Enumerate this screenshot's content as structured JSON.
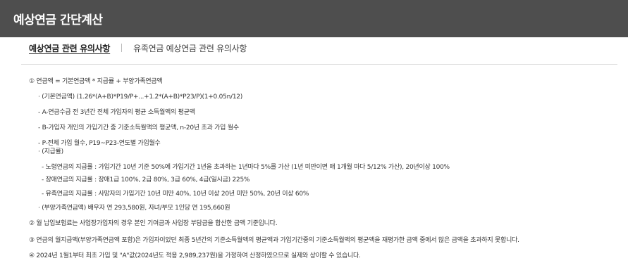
{
  "header": {
    "title": "예상연금 간단계산"
  },
  "tabs": [
    {
      "label": "예상연금 관련 유의사항",
      "active": true
    },
    {
      "label": "유족연금 예상연금 관련 유의사항",
      "active": false
    }
  ],
  "notes": {
    "n1": "① 연금액 = 기본연금액 * 지급률 + 부양가족연금액",
    "n1_a": "· (기본연금액) (1.26*(A+B)*P19/P+...+1.2*(A+B)*P23/P)(1+0.05n/12)",
    "n1_b": "- A-연금수급 전 3년간 전체 가입자의 평균 소득월액의 평균액",
    "n1_c": "- B-가입자 개인의 가입기간 중 기준소득월액의 평균액, n-20년 초과 가입 월수",
    "n1_d": "- P-전체 가입 월수, P19~P23-연도별 가입월수",
    "n1_e": "· (지급률)",
    "n1_e1": "- 노령연금의 지급률 : 가입기간 10년 기준 50%에 가입기간 1년을 초과하는 1년마다 5%를 가산 (1년 미만이면 매 1개월 마다 5/12% 가산), 20년이상 100%",
    "n1_e2": "- 장애연금의 지급률 : 장애1급 100%, 2급 80%, 3급 60%, 4급(일시금) 225%",
    "n1_e3": "- 유족연금의 지급률 : 사망자의 가입기간 10년 미만 40%, 10년 이상 20년 미만 50%, 20년 이상 60%",
    "n1_f": "· (부양가족연금액) 배우자 연 293,580원, 자녀/부모 1인당 연 195,660원",
    "n2": "② 월 납입보험료는 사업장가입자의 경우 본인 기여금과 사업장 부담금을 합산한 금액 기준입니다.",
    "n3": "③ 연금의 월지급액(부양가족연금액 포함)은 가입자이었던 최종 5년간의 기준소득월액의 평균액과 가입기간중의 기준소득월액의 평균액을 재평가한 금액 중에서 많은 금액을 초과하지 못합니다.",
    "n4": "④ 2024년 1월1부터 최초 가입 및 \"A\"값(2024년도 적용 2,989,237원)을 가정하여 산정하였으므로 실제와 상이할 수 있습니다."
  }
}
